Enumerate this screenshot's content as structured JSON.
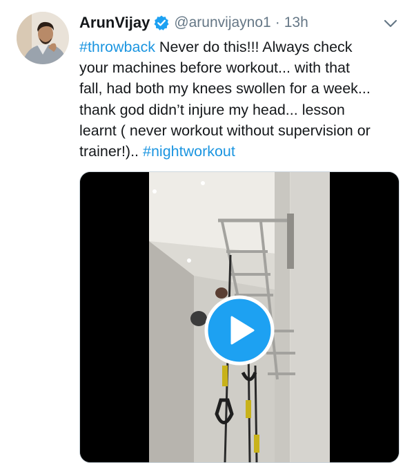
{
  "tweet": {
    "display_name": "ArunVijay",
    "handle": "@arunvijayno1",
    "separator": "·",
    "time": "13h",
    "verified": true,
    "text_lines": [
      {
        "hashtag": "#throwback",
        "after": " Never do this!!! Always check"
      },
      {
        "text": "your machines before workout... with that"
      },
      {
        "text": "fall, had  both my knees swollen for a week..."
      },
      {
        "text": "thank god didn’t injure my head... lesson"
      },
      {
        "text": "learnt ( never workout without supervision or"
      },
      {
        "before": "trainer!).. ",
        "hashtag": "#nightworkout"
      }
    ]
  },
  "icons": {
    "verified": "verified-badge-icon",
    "caret": "chevron-down-icon",
    "play": "play-icon"
  },
  "colors": {
    "link": "#1b95e0",
    "verified": "#1da1f2",
    "muted": "#657786",
    "play_button": "#1da1f2"
  }
}
